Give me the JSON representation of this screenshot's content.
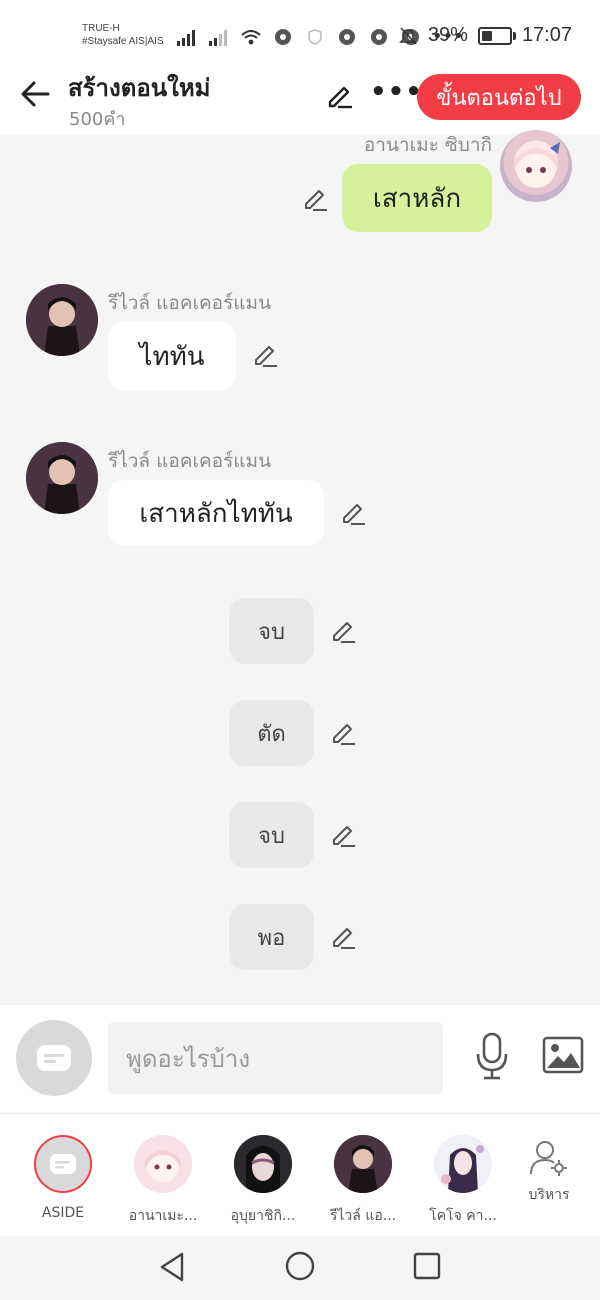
{
  "status_bar": {
    "carrier_line1": "TRUE-H",
    "carrier_line2": "#Staysafe AIS|AIS",
    "battery": "39%",
    "battery_level": 0.39,
    "time": "17:07"
  },
  "header": {
    "title": "สร้างตอนใหม่",
    "word_count": "500คำ",
    "next_label": "ขั้นตอนต่อไป",
    "accent": "#f23d47"
  },
  "messages": [
    {
      "speaker": "อานาเมะ ซิบากิ",
      "text": "เสาหลัก",
      "side": "right"
    },
    {
      "speaker": "รีไวล์ แอคเคอร์แมน",
      "text": "ไททัน",
      "side": "left"
    },
    {
      "speaker": "รีไวล์ แอคเคอร์แมน",
      "text": "เสาหลักไททัน",
      "side": "left"
    }
  ],
  "narration": [
    "จบ",
    "ตัด",
    "จบ",
    "พอ"
  ],
  "composer": {
    "placeholder": "พูดอะไรบ้าง"
  },
  "characters": [
    {
      "label": "ASIDE"
    },
    {
      "label": "อานาเมะ..."
    },
    {
      "label": "อุบุยาชิกิ..."
    },
    {
      "label": "รีไวล์ แอ..."
    },
    {
      "label": "โคโจ คา..."
    },
    {
      "label": "บริหาร"
    }
  ]
}
